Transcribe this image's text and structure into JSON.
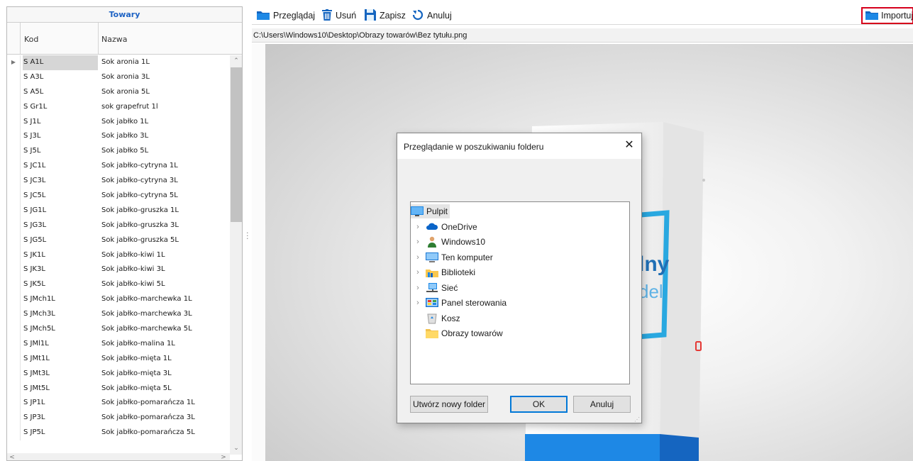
{
  "left_panel": {
    "title": "Towary",
    "columns": {
      "kod": "Kod",
      "nazwa": "Nazwa"
    },
    "rows": [
      {
        "kod": "S A1L",
        "nazwa": "Sok aronia 1L",
        "selected": true
      },
      {
        "kod": "S A3L",
        "nazwa": "Sok aronia 3L"
      },
      {
        "kod": "S A5L",
        "nazwa": "Sok aronia 5L"
      },
      {
        "kod": "S Gr1L",
        "nazwa": "sok grapefrut 1l"
      },
      {
        "kod": "S J1L",
        "nazwa": "Sok jabłko 1L"
      },
      {
        "kod": "S J3L",
        "nazwa": "Sok jabłko 3L"
      },
      {
        "kod": "S J5L",
        "nazwa": "Sok jabłko 5L"
      },
      {
        "kod": "S JC1L",
        "nazwa": "Sok jabłko-cytryna 1L"
      },
      {
        "kod": "S JC3L",
        "nazwa": "Sok jabłko-cytryna 3L"
      },
      {
        "kod": "S JC5L",
        "nazwa": "Sok jabłko-cytryna 5L"
      },
      {
        "kod": "S JG1L",
        "nazwa": "Sok jabłko-gruszka 1L"
      },
      {
        "kod": "S JG3L",
        "nazwa": "Sok jabłko-gruszka 3L"
      },
      {
        "kod": "S JG5L",
        "nazwa": "Sok jabłko-gruszka 5L"
      },
      {
        "kod": "S JK1L",
        "nazwa": "Sok jabłko-kiwi 1L"
      },
      {
        "kod": "S JK3L",
        "nazwa": "Sok jabłko-kiwi 3L"
      },
      {
        "kod": "S JK5L",
        "nazwa": "Sok jabłko-kiwi 5L"
      },
      {
        "kod": "S JMch1L",
        "nazwa": "Sok jabłko-marchewka 1L"
      },
      {
        "kod": "S JMch3L",
        "nazwa": "Sok jabłko-marchewka 3L"
      },
      {
        "kod": "S JMch5L",
        "nazwa": "Sok jabłko-marchewka 5L"
      },
      {
        "kod": "S JMl1L",
        "nazwa": "Sok jabłko-malina 1L"
      },
      {
        "kod": "S JMt1L",
        "nazwa": "Sok jabłko-mięta 1L"
      },
      {
        "kod": "S JMt3L",
        "nazwa": "Sok jabłko-mięta 3L"
      },
      {
        "kod": "S JMt5L",
        "nazwa": "Sok jabłko-mięta 5L"
      },
      {
        "kod": "S JP1L",
        "nazwa": "Sok jabłko-pomarańcza 1L"
      },
      {
        "kod": "S JP3L",
        "nazwa": "Sok jabłko-pomarańcza 3L"
      },
      {
        "kod": "S JP5L",
        "nazwa": "Sok jabłko-pomarańcza 5L"
      }
    ]
  },
  "toolbar": {
    "browse_label": "Przeglądaj",
    "delete_label": "Usuń",
    "save_label": "Zapisz",
    "cancel_label": "Anuluj",
    "import_label": "Importuj"
  },
  "path": "C:\\Users\\Windows10\\Desktop\\Obrazy towarów\\Bez tytułu.png",
  "preview": {
    "box_text_1": "lny",
    "box_text_2": "del"
  },
  "dialog": {
    "title": "Przeglądanie w poszukiwaniu folderu",
    "tree": [
      {
        "label": "Pulpit",
        "icon": "desktop-icon",
        "level": 0,
        "expandable": false,
        "selected": true
      },
      {
        "label": "OneDrive",
        "icon": "onedrive-icon",
        "level": 1,
        "expandable": true
      },
      {
        "label": "Windows10",
        "icon": "user-icon",
        "level": 1,
        "expandable": true
      },
      {
        "label": "Ten komputer",
        "icon": "computer-icon",
        "level": 1,
        "expandable": true
      },
      {
        "label": "Biblioteki",
        "icon": "libraries-icon",
        "level": 1,
        "expandable": true
      },
      {
        "label": "Sieć",
        "icon": "network-icon",
        "level": 1,
        "expandable": true
      },
      {
        "label": "Panel sterowania",
        "icon": "control-panel-icon",
        "level": 1,
        "expandable": true
      },
      {
        "label": "Kosz",
        "icon": "recycle-bin-icon",
        "level": 1,
        "expandable": false
      },
      {
        "label": "Obrazy towarów",
        "icon": "folder-icon",
        "level": 1,
        "expandable": false
      }
    ],
    "new_folder_label": "Utwórz nowy folder",
    "ok_label": "OK",
    "cancel_label": "Anuluj"
  },
  "colors": {
    "accent_blue": "#1e63c4",
    "highlight_red": "#d6001c",
    "ok_focus": "#0078d7"
  }
}
